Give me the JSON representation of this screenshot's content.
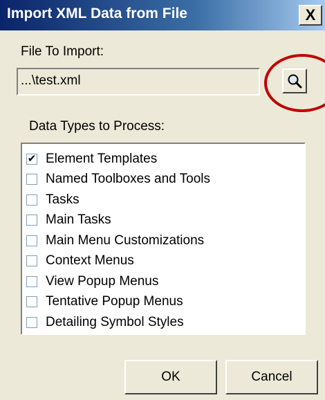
{
  "window": {
    "title": "Import XML Data from File",
    "close_label": "X"
  },
  "file_section": {
    "label": "File To Import:",
    "value": "...\\test.xml",
    "browse_icon": "magnifier-icon"
  },
  "data_types": {
    "label": "Data Types to Process:",
    "items": [
      {
        "label": "Element Templates",
        "checked": true
      },
      {
        "label": "Named Toolboxes and Tools",
        "checked": false
      },
      {
        "label": "Tasks",
        "checked": false
      },
      {
        "label": "Main Tasks",
        "checked": false
      },
      {
        "label": "Main Menu Customizations",
        "checked": false
      },
      {
        "label": "Context Menus",
        "checked": false
      },
      {
        "label": "View Popup Menus",
        "checked": false
      },
      {
        "label": "Tentative Popup Menus",
        "checked": false
      },
      {
        "label": "Detailing Symbol Styles",
        "checked": false
      }
    ]
  },
  "buttons": {
    "ok_label": "OK",
    "cancel_label": "Cancel"
  },
  "colors": {
    "highlight": "#c00000",
    "title_bar": "#0a246a"
  }
}
